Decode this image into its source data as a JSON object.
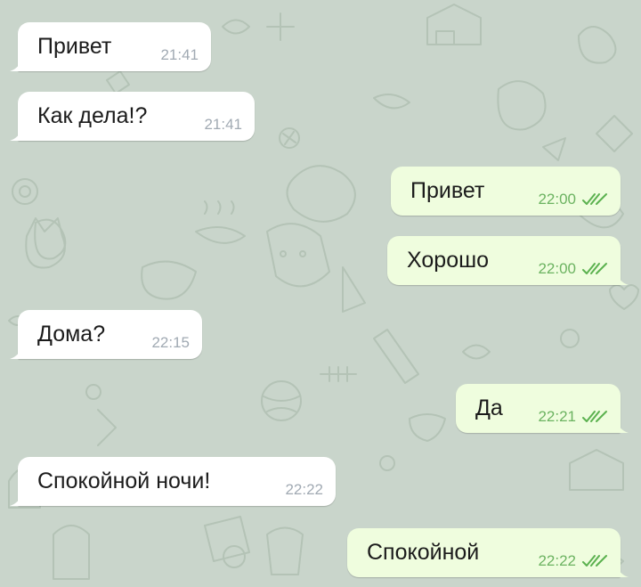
{
  "chat": {
    "colors": {
      "background": "#c9d5cb",
      "incoming_bubble": "#ffffff",
      "outgoing_bubble": "#effdde",
      "incoming_time": "#a1aab3",
      "outgoing_time": "#6cb361",
      "read_check": "#5bb14f"
    },
    "messages": [
      {
        "direction": "incoming",
        "text": "Привет",
        "time": "21:41"
      },
      {
        "direction": "incoming",
        "text": "Как дела!?",
        "time": "21:41"
      },
      {
        "direction": "outgoing",
        "text": "Привет",
        "time": "22:00",
        "status": "read",
        "status_icon": "double-check-icon"
      },
      {
        "direction": "outgoing",
        "text": "Хорошо",
        "time": "22:00",
        "status": "read",
        "status_icon": "double-check-icon"
      },
      {
        "direction": "incoming",
        "text": "Дома?",
        "time": "22:15"
      },
      {
        "direction": "outgoing",
        "text": "Да",
        "time": "22:21",
        "status": "read",
        "status_icon": "double-check-icon"
      },
      {
        "direction": "incoming",
        "text": "Спокойной ночи!",
        "time": "22:22"
      },
      {
        "direction": "outgoing",
        "text": "Спокойной",
        "time": "22:22",
        "status": "read",
        "status_icon": "double-check-icon"
      }
    ]
  }
}
